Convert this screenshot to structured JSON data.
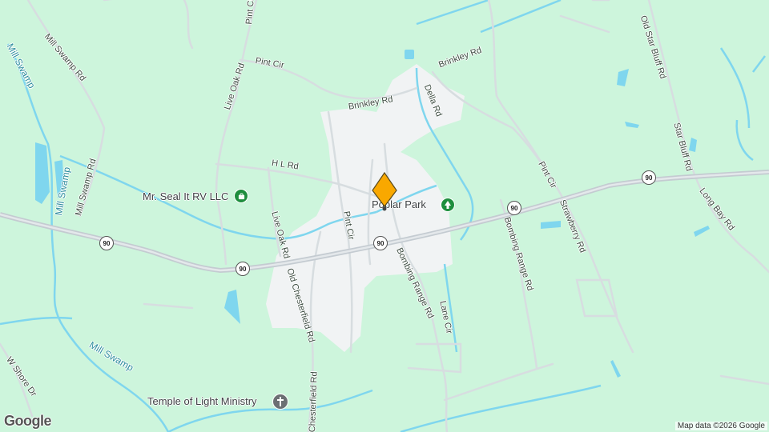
{
  "map": {
    "roads": [
      {
        "id": "old-star-bluff",
        "label": "Old Star Bluff Rd"
      },
      {
        "id": "brinkley-top",
        "label": "Brinkley Rd"
      },
      {
        "id": "brinkley-mid",
        "label": "Brinkley Rd"
      },
      {
        "id": "della",
        "label": "Della Rd"
      },
      {
        "id": "pint-cir-top",
        "label": "Pint Cir"
      },
      {
        "id": "pint-cir-nw",
        "label": "Pint Cir"
      },
      {
        "id": "live-oak-n",
        "label": "Live Oak Rd"
      },
      {
        "id": "mill-swamp-rd",
        "label": "Mill Swamp Rd"
      },
      {
        "id": "mill-swamp-rd-2",
        "label": "Mill Swamp Rd"
      },
      {
        "id": "hl",
        "label": "H L Rd"
      },
      {
        "id": "live-oak-s",
        "label": "Live Oak Rd"
      },
      {
        "id": "pint-cir-center",
        "label": "Pint Cir"
      },
      {
        "id": "pint-cir-east",
        "label": "Pint Cir"
      },
      {
        "id": "strawberry",
        "label": "Strawberry Rd"
      },
      {
        "id": "star-bluff",
        "label": "Star Bluff Rd"
      },
      {
        "id": "long-bay",
        "label": "Long Bay Rd"
      },
      {
        "id": "bombing-range-center",
        "label": "Bombing Range Rd"
      },
      {
        "id": "bombing-range-east",
        "label": "Bombing Range Rd"
      },
      {
        "id": "old-chesterfield",
        "label": "Old Chesterfield Rd"
      },
      {
        "id": "chesterfield",
        "label": "Chesterfield Rd"
      },
      {
        "id": "lane-cir",
        "label": "Lane Cir"
      },
      {
        "id": "w-shore",
        "label": "W Shore Dr"
      }
    ],
    "water": [
      {
        "id": "mill-swamp-1",
        "label": "Mill Swamp"
      },
      {
        "id": "mill-swamp-2",
        "label": "Mill Swamp"
      },
      {
        "id": "mill-swamp-3",
        "label": "Mill Swamp"
      }
    ],
    "highway_shields": [
      {
        "id": "hwy-1",
        "label": "90"
      },
      {
        "id": "hwy-2",
        "label": "90"
      },
      {
        "id": "hwy-3",
        "label": "90"
      },
      {
        "id": "hwy-4",
        "label": "90"
      },
      {
        "id": "hwy-5",
        "label": "90"
      }
    ],
    "places": {
      "mr_seal": {
        "label": "Mr. Seal It RV LLC",
        "icon": "shopping-bag-icon"
      },
      "poplar_park": {
        "label": "Poplar Park",
        "icon": "tree-icon"
      },
      "temple": {
        "label": "Temple of Light Ministry",
        "icon": "cross-icon"
      }
    },
    "marker": {
      "icon": "diamond-location-marker-icon",
      "color": "#f9a800"
    },
    "colors": {
      "land": "#cdf5dc",
      "town": "#f1f3f4",
      "road": "#d4dadc",
      "highway": "#c6ccd2",
      "water": "#7fd6ee"
    }
  },
  "footer": {
    "logo": "Google",
    "attribution": "Map data ©2026 Google"
  }
}
